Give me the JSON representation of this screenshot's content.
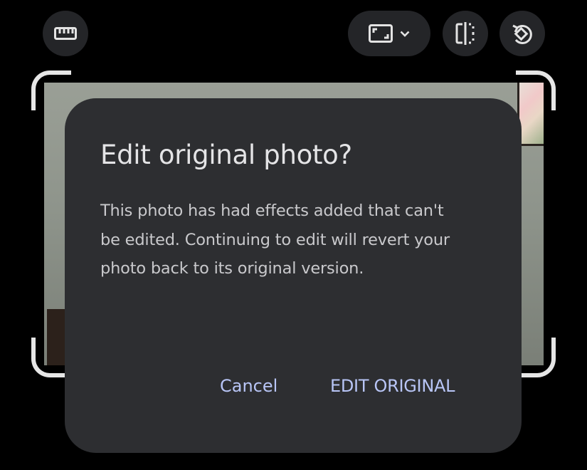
{
  "toolbar": {
    "ruler_icon": "ruler-icon",
    "aspect_icon": "aspect-ratio-icon",
    "aspect_chevron_icon": "chevron-down-icon",
    "flip_icon": "flip-horizontal-icon",
    "rotate_icon": "rotate-icon"
  },
  "dialog": {
    "title": "Edit original photo?",
    "body": "This photo has had effects added that can't be edited. Continuing to edit will revert your photo back to its original version.",
    "cancel_label": "Cancel",
    "confirm_label": "EDIT ORIGINAL"
  },
  "colors": {
    "background": "#000000",
    "dialog_surface": "#2d2e31",
    "toolbar_button": "#242528",
    "dialog_title": "#e4e4e6",
    "dialog_body": "#c9c9cc",
    "action_text": "#b8c5f6",
    "crop_handle": "#e6e6e6"
  }
}
